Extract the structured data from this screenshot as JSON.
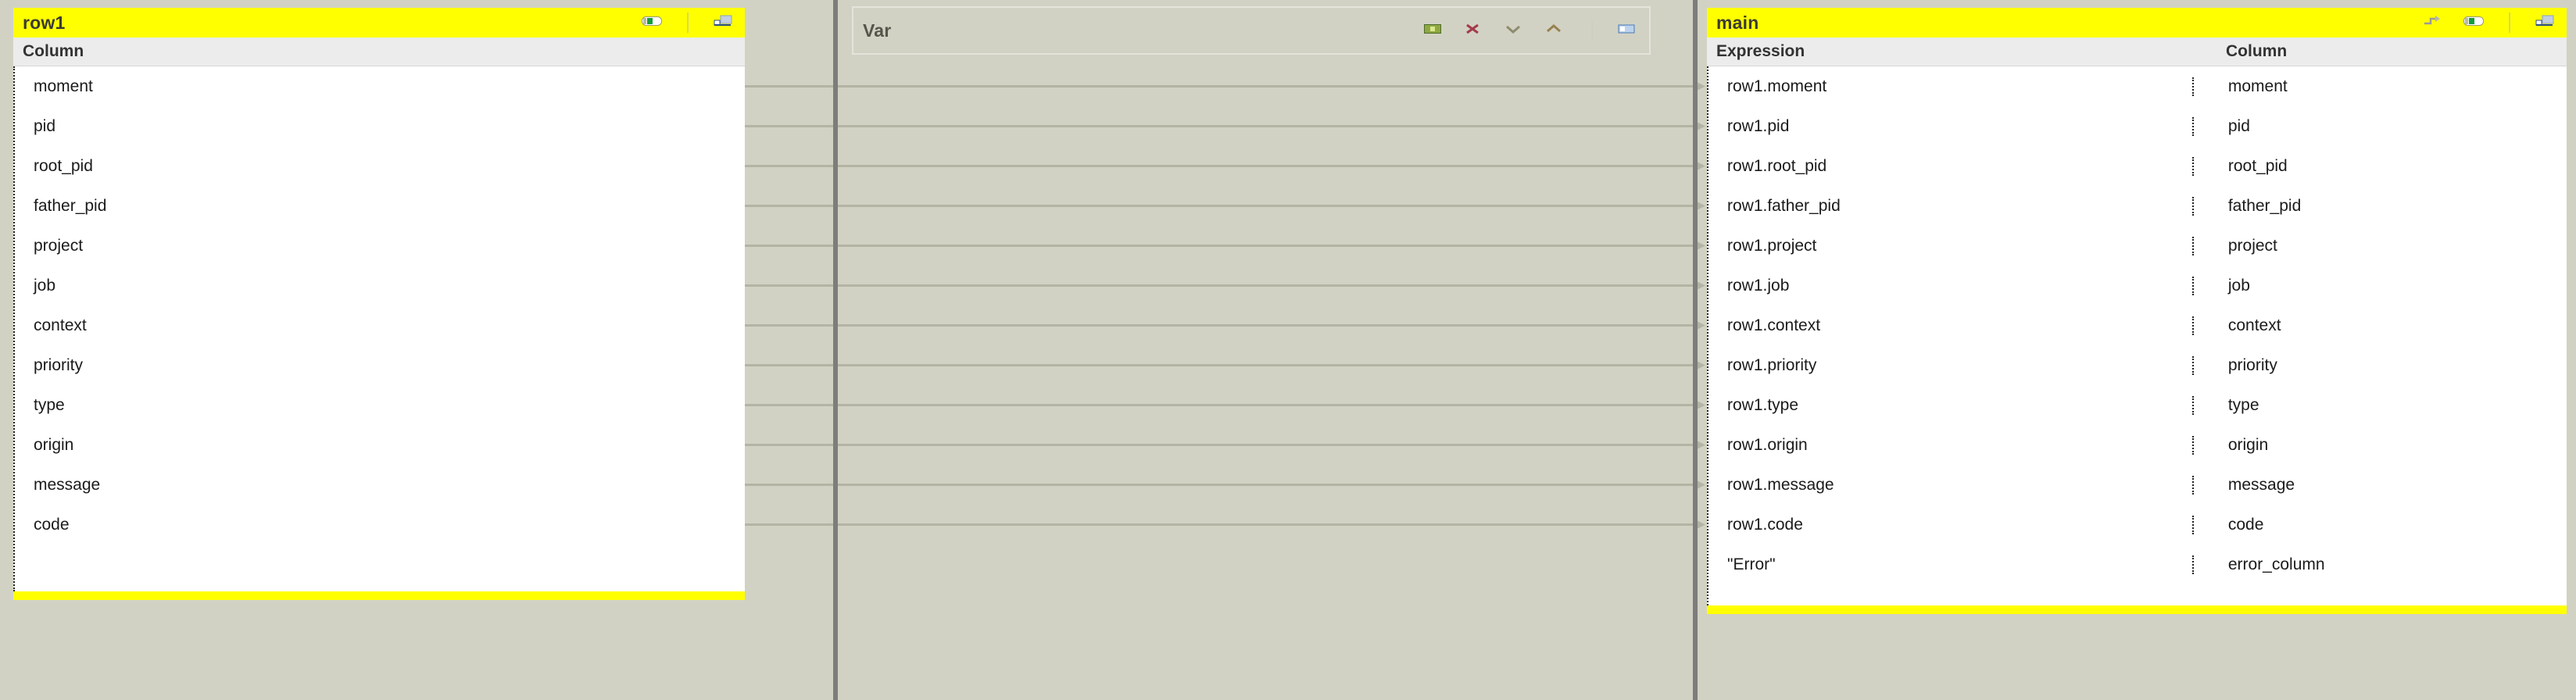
{
  "background_color": "#d2d2c4",
  "accent_color": "#ffff00",
  "panels": {
    "left": {
      "title": "row1",
      "header": {
        "column": "Column"
      },
      "toolbar": [
        {
          "name": "toggle-minimap-icon",
          "label": ""
        },
        {
          "name": "maximize-panel-icon",
          "label": ""
        }
      ],
      "rows": [
        {
          "column": "moment"
        },
        {
          "column": "pid"
        },
        {
          "column": "root_pid"
        },
        {
          "column": "father_pid"
        },
        {
          "column": "project"
        },
        {
          "column": "job"
        },
        {
          "column": "context"
        },
        {
          "column": "priority"
        },
        {
          "column": "type"
        },
        {
          "column": "origin"
        },
        {
          "column": "message"
        },
        {
          "column": "code"
        }
      ]
    },
    "middle": {
      "title": "Var",
      "toolbar": [
        {
          "name": "add-variable-icon",
          "label": ""
        },
        {
          "name": "remove-variable-icon",
          "label": ""
        },
        {
          "name": "move-down-icon",
          "label": ""
        },
        {
          "name": "move-up-icon",
          "label": ""
        },
        {
          "name": "maximize-panel-icon",
          "label": ""
        }
      ],
      "rows": []
    },
    "right": {
      "title": "main",
      "header": {
        "expression": "Expression",
        "column": "Column"
      },
      "toolbar": [
        {
          "name": "auto-map-icon",
          "label": ""
        },
        {
          "name": "toggle-minimap-icon",
          "label": ""
        },
        {
          "name": "maximize-panel-icon",
          "label": ""
        }
      ],
      "rows": [
        {
          "expression": "row1.moment",
          "column": "moment"
        },
        {
          "expression": "row1.pid",
          "column": "pid"
        },
        {
          "expression": "row1.root_pid",
          "column": "root_pid"
        },
        {
          "expression": "row1.father_pid",
          "column": "father_pid"
        },
        {
          "expression": "row1.project",
          "column": "project"
        },
        {
          "expression": "row1.job",
          "column": "job"
        },
        {
          "expression": "row1.context",
          "column": "context"
        },
        {
          "expression": "row1.priority",
          "column": "priority"
        },
        {
          "expression": "row1.type",
          "column": "type"
        },
        {
          "expression": "row1.origin",
          "column": "origin"
        },
        {
          "expression": "row1.message",
          "column": "message"
        },
        {
          "expression": "row1.code",
          "column": "code"
        },
        {
          "expression": "\"Error\"",
          "column": "error_column"
        }
      ]
    }
  },
  "links": [
    {
      "from": "row1.moment",
      "to": "moment"
    },
    {
      "from": "row1.pid",
      "to": "pid"
    },
    {
      "from": "row1.root_pid",
      "to": "root_pid"
    },
    {
      "from": "row1.father_pid",
      "to": "father_pid"
    },
    {
      "from": "row1.project",
      "to": "project"
    },
    {
      "from": "row1.job",
      "to": "job"
    },
    {
      "from": "row1.context",
      "to": "context"
    },
    {
      "from": "row1.priority",
      "to": "priority"
    },
    {
      "from": "row1.type",
      "to": "type"
    },
    {
      "from": "row1.origin",
      "to": "origin"
    },
    {
      "from": "row1.message",
      "to": "message"
    },
    {
      "from": "row1.code",
      "to": "code"
    }
  ]
}
